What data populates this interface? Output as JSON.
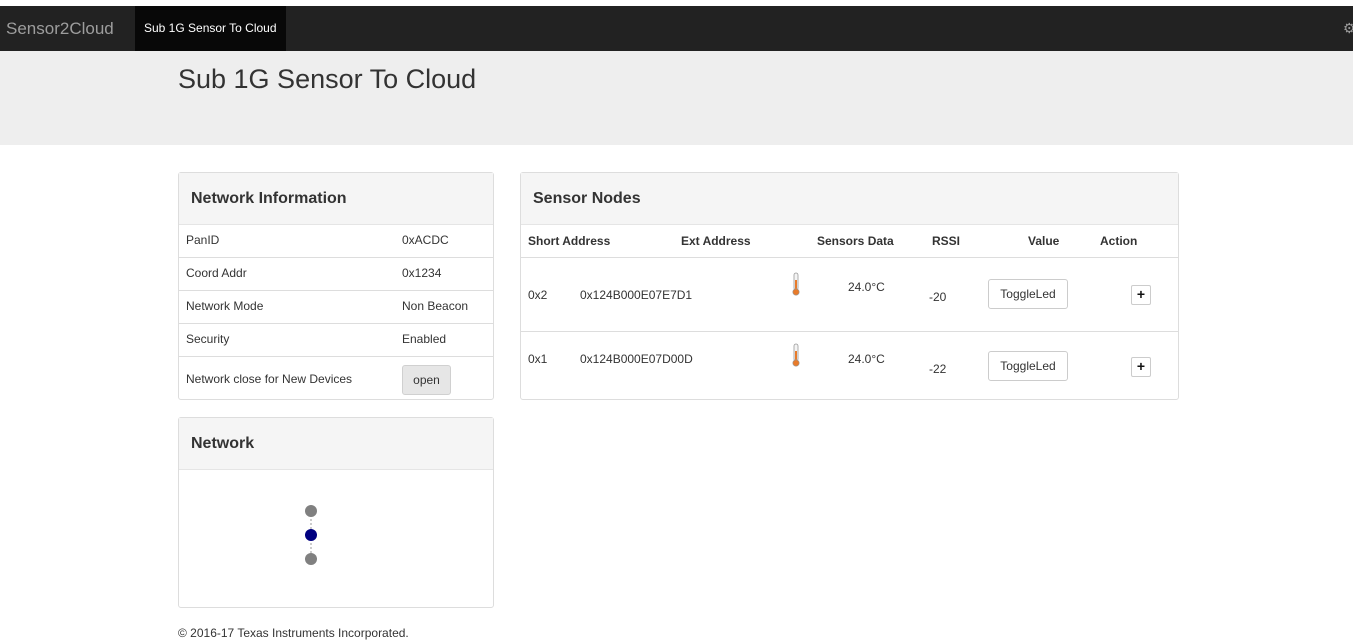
{
  "navbar": {
    "brand": "Sensor2Cloud",
    "active_tab": "Sub 1G Sensor To Cloud",
    "settings_icon": "gear-icon"
  },
  "page": {
    "title": "Sub 1G Sensor To Cloud"
  },
  "network_info": {
    "heading": "Network Information",
    "rows": [
      {
        "key": "PanID",
        "value": "0xACDC"
      },
      {
        "key": "Coord Addr",
        "value": "0x1234"
      },
      {
        "key": "Network Mode",
        "value": "Non Beacon"
      },
      {
        "key": "Security",
        "value": "Enabled"
      }
    ],
    "join_row": {
      "key": "Network close for New Devices",
      "button_label": "open"
    }
  },
  "network": {
    "heading": "Network",
    "node_colors": {
      "coordinator": "#000080",
      "sensor": "#808080"
    }
  },
  "sensor_nodes": {
    "heading": "Sensor Nodes",
    "columns": [
      "Short Address",
      "Ext Address",
      "Sensors Data",
      "RSSI",
      "Value",
      "Action"
    ],
    "rows": [
      {
        "short": "0x2",
        "ext": "0x124B000E07E7D1",
        "temp": "24.0°C",
        "rssi": "-20",
        "button": "ToggleLed",
        "action": "+"
      },
      {
        "short": "0x1",
        "ext": "0x124B000E07D00D",
        "temp": "24.0°C",
        "rssi": "-22",
        "button": "ToggleLed",
        "action": "+"
      }
    ]
  },
  "footer": {
    "copyright": "© 2016-17 Texas Instruments Incorporated."
  }
}
